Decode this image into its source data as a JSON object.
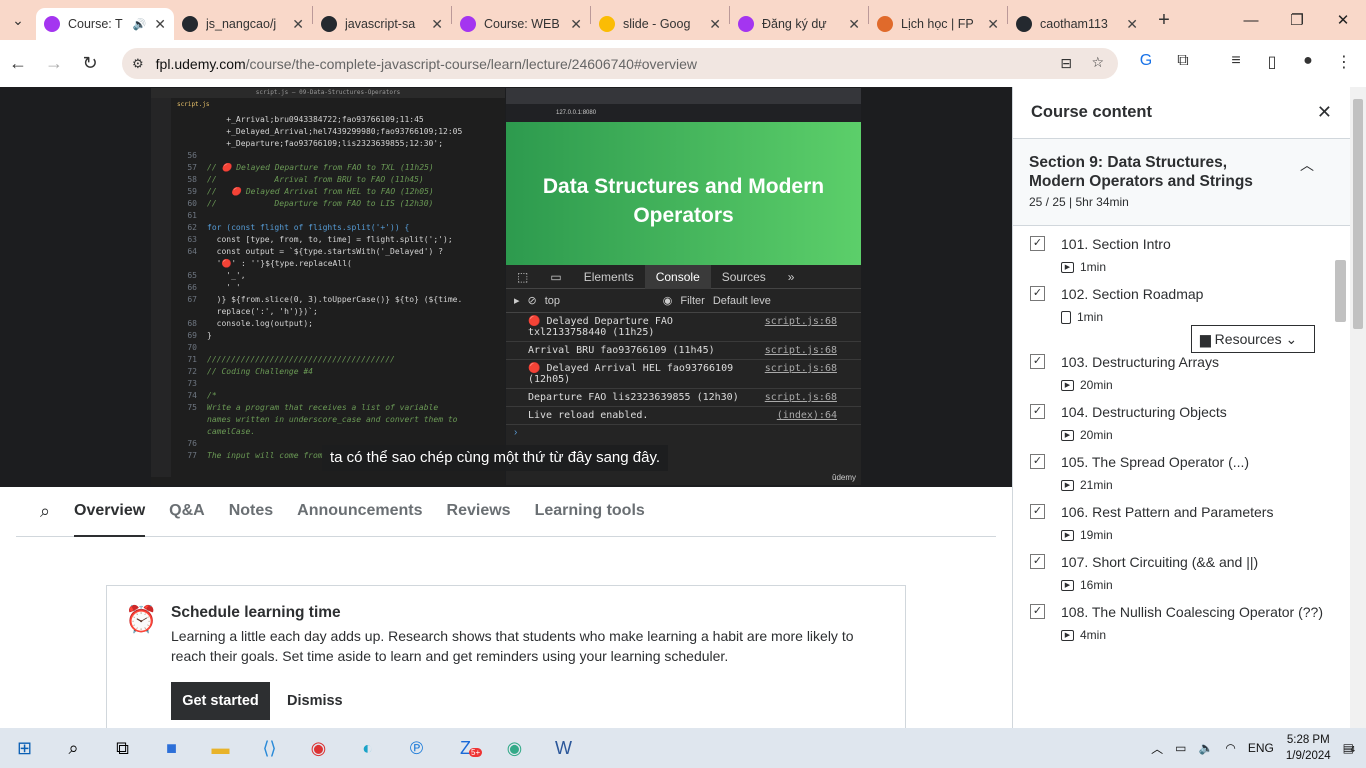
{
  "browser": {
    "tabs": [
      {
        "title": "Course: T",
        "active": true,
        "color": "#a435f0"
      },
      {
        "title": "js_nangcao/j",
        "color": "#24292f"
      },
      {
        "title": "javascript-sa",
        "color": "#24292f"
      },
      {
        "title": "Course: WEB",
        "color": "#a435f0"
      },
      {
        "title": "slide - Goog",
        "color": "#fbbc04"
      },
      {
        "title": "Đăng ký dự",
        "color": "#a435f0"
      },
      {
        "title": "Lịch học | FP",
        "color": "#e06a2b"
      },
      {
        "title": "caotham113",
        "color": "#24292f"
      }
    ],
    "url_host": "fpl.udemy.com",
    "url_path": "/course/the-complete-javascript-course/learn/lecture/24606740#overview"
  },
  "video": {
    "vscode_title": "script.js — 09-Data-Structures-Operators",
    "vscode_tab": "script.js",
    "code_lines": [
      {
        "n": "",
        "t": "    +_Arrival;bru0943384722;fao93766109;11:45"
      },
      {
        "n": "",
        "t": "    +_Delayed_Arrival;hel7439299980;fao93766109;12:05"
      },
      {
        "n": "",
        "t": "    +_Departure;fao93766109;lis2323639855;12:30';"
      },
      {
        "n": "56",
        "t": ""
      },
      {
        "n": "57",
        "t": "// 🔴 Delayed Departure from FAO to TXL (11h25)",
        "c": "cm"
      },
      {
        "n": "58",
        "t": "//            Arrival from BRU to FAO (11h45)",
        "c": "cm"
      },
      {
        "n": "59",
        "t": "//   🔴 Delayed Arrival from HEL to FAO (12h05)",
        "c": "cm"
      },
      {
        "n": "60",
        "t": "//            Departure from FAO to LIS (12h30)",
        "c": "cm"
      },
      {
        "n": "61",
        "t": ""
      },
      {
        "n": "62",
        "t": "for (const flight of flights.split('+')) {",
        "c": "kw"
      },
      {
        "n": "63",
        "t": "  const [type, from, to, time] = flight.split(';');"
      },
      {
        "n": "64",
        "t": "  const output = `${type.startsWith('_Delayed') ?"
      },
      {
        "n": "",
        "t": "  '🔴' : ''}${type.replaceAll("
      },
      {
        "n": "65",
        "t": "    '_',"
      },
      {
        "n": "66",
        "t": "    ' '"
      },
      {
        "n": "67",
        "t": "  )} ${from.slice(0, 3).toUpperCase()} ${to} (${time."
      },
      {
        "n": "",
        "t": "  replace(':', 'h')})`;"
      },
      {
        "n": "68",
        "t": "  console.log(output);"
      },
      {
        "n": "69",
        "t": "}"
      },
      {
        "n": "70",
        "t": ""
      },
      {
        "n": "71",
        "t": "///////////////////////////////////////",
        "c": "cm"
      },
      {
        "n": "72",
        "t": "// Coding Challenge #4",
        "c": "cm"
      },
      {
        "n": "73",
        "t": ""
      },
      {
        "n": "74",
        "t": "/*",
        "c": "cm"
      },
      {
        "n": "75",
        "t": "Write a program that receives a list of variable",
        "c": "cm"
      },
      {
        "n": "",
        "t": "names written in underscore_case and convert them to",
        "c": "cm"
      },
      {
        "n": "",
        "t": "camelCase.",
        "c": "cm"
      },
      {
        "n": "76",
        "t": ""
      },
      {
        "n": "77",
        "t": "The input will come from",
        "c": "cm"
      }
    ],
    "browser_url": "127.0.0.1:8080",
    "slide_title": "Data Structures and Modern Operators",
    "devtools_tabs": [
      "Elements",
      "Console",
      "Sources",
      "»"
    ],
    "console_context": "top",
    "console_filter_placeholder": "Filter",
    "console_level": "Default leve",
    "console_rows": [
      {
        "msg": "🔴 Delayed Departure FAO txl2133758440 (11h25)",
        "src": "script.js:68"
      },
      {
        "msg": " Arrival BRU fao93766109 (11h45)",
        "src": "script.js:68"
      },
      {
        "msg": "🔴 Delayed Arrival HEL fao93766109 (12h05)",
        "src": "script.js:68"
      },
      {
        "msg": " Departure FAO lis2323639855 (12h30)",
        "src": "script.js:68"
      },
      {
        "msg": "Live reload enabled.",
        "src": "(index):64"
      }
    ],
    "caption": "ta có thể sao chép cùng một thứ từ đây sang đây.",
    "watermark": "ûdemy"
  },
  "lecture_tabs": [
    "Overview",
    "Q&A",
    "Notes",
    "Announcements",
    "Reviews",
    "Learning tools"
  ],
  "schedule": {
    "title": "Schedule learning time",
    "body": "Learning a little each day adds up. Research shows that students who make learning a habit are more likely to reach their goals. Set time aside to learn and get reminders using your learning scheduler.",
    "primary": "Get started",
    "secondary": "Dismiss"
  },
  "sidebar": {
    "title": "Course content",
    "section_title": "Section 9: Data Structures, Modern Operators and Strings",
    "section_meta": "25 / 25 | 5hr 34min",
    "resources_label": "Resources",
    "lectures": [
      {
        "name": "101. Section Intro",
        "duration": "1min",
        "kind": "video"
      },
      {
        "name": "102. Section Roadmap",
        "duration": "1min",
        "kind": "file"
      },
      {
        "name": "103. Destructuring Arrays",
        "duration": "20min",
        "kind": "video"
      },
      {
        "name": "104. Destructuring Objects",
        "duration": "20min",
        "kind": "video"
      },
      {
        "name": "105. The Spread Operator (...)",
        "duration": "21min",
        "kind": "video"
      },
      {
        "name": "106. Rest Pattern and Parameters",
        "duration": "19min",
        "kind": "video"
      },
      {
        "name": "107. Short Circuiting (&& and ||)",
        "duration": "16min",
        "kind": "video"
      },
      {
        "name": "108. The Nullish Coalescing Operator (??)",
        "duration": "4min",
        "kind": "video"
      }
    ]
  },
  "taskbar": {
    "lang": "ENG",
    "time": "5:28 PM",
    "date": "1/9/2024",
    "notif_count": "4",
    "badge": "5+"
  }
}
